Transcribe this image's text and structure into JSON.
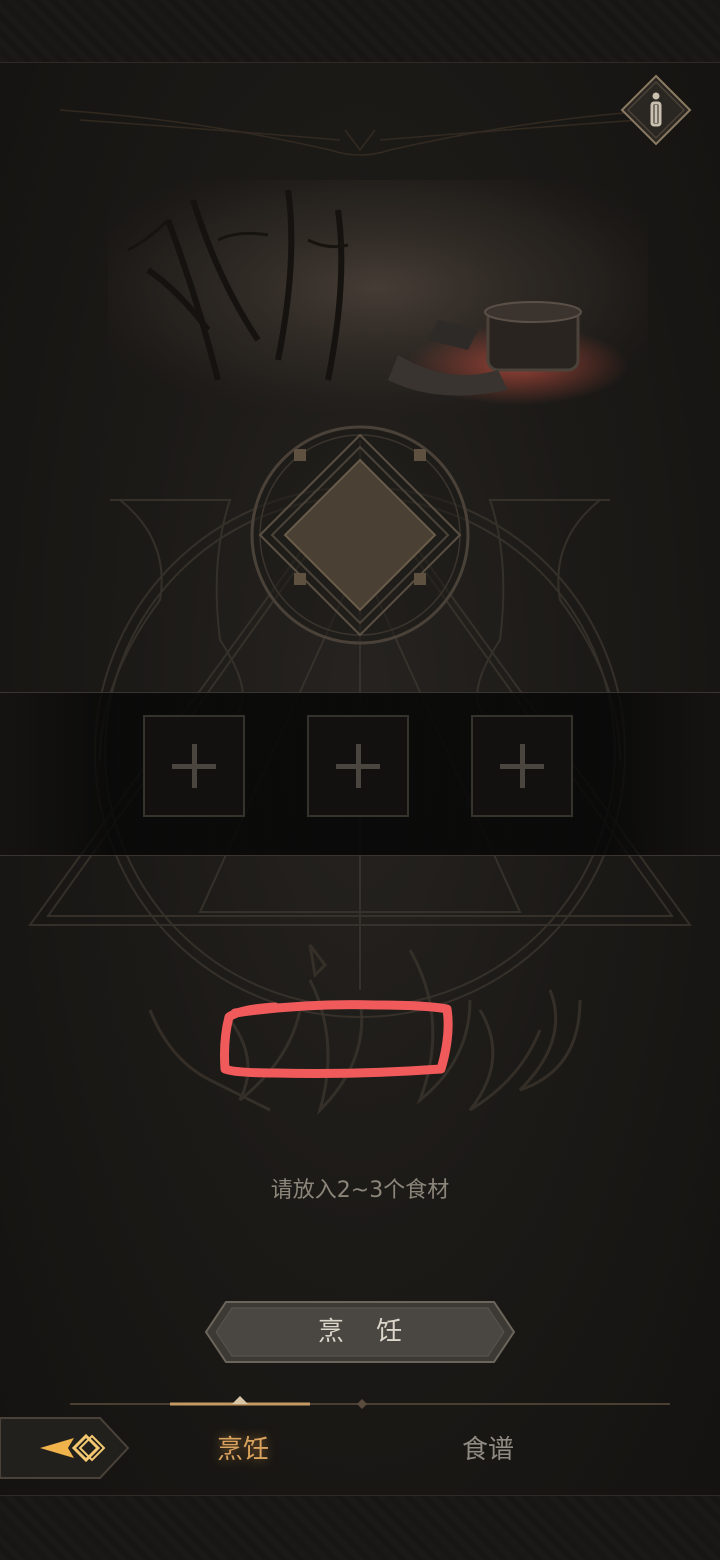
{
  "hint": "请放入2~3个食材",
  "cook_button": {
    "label": "烹 饪"
  },
  "tabs": [
    {
      "label": "烹饪",
      "active": true
    },
    {
      "label": "食谱",
      "active": false
    }
  ],
  "ingredient_slots": [
    {
      "icon": "plus-icon"
    },
    {
      "icon": "plus-icon"
    },
    {
      "icon": "plus-icon"
    }
  ],
  "colors": {
    "accent": "#d9a25e",
    "background": "#1c1a17",
    "annotation": "#f05a5a"
  },
  "icons": {
    "info": "info-icon",
    "back": "arrow-back-icon"
  }
}
